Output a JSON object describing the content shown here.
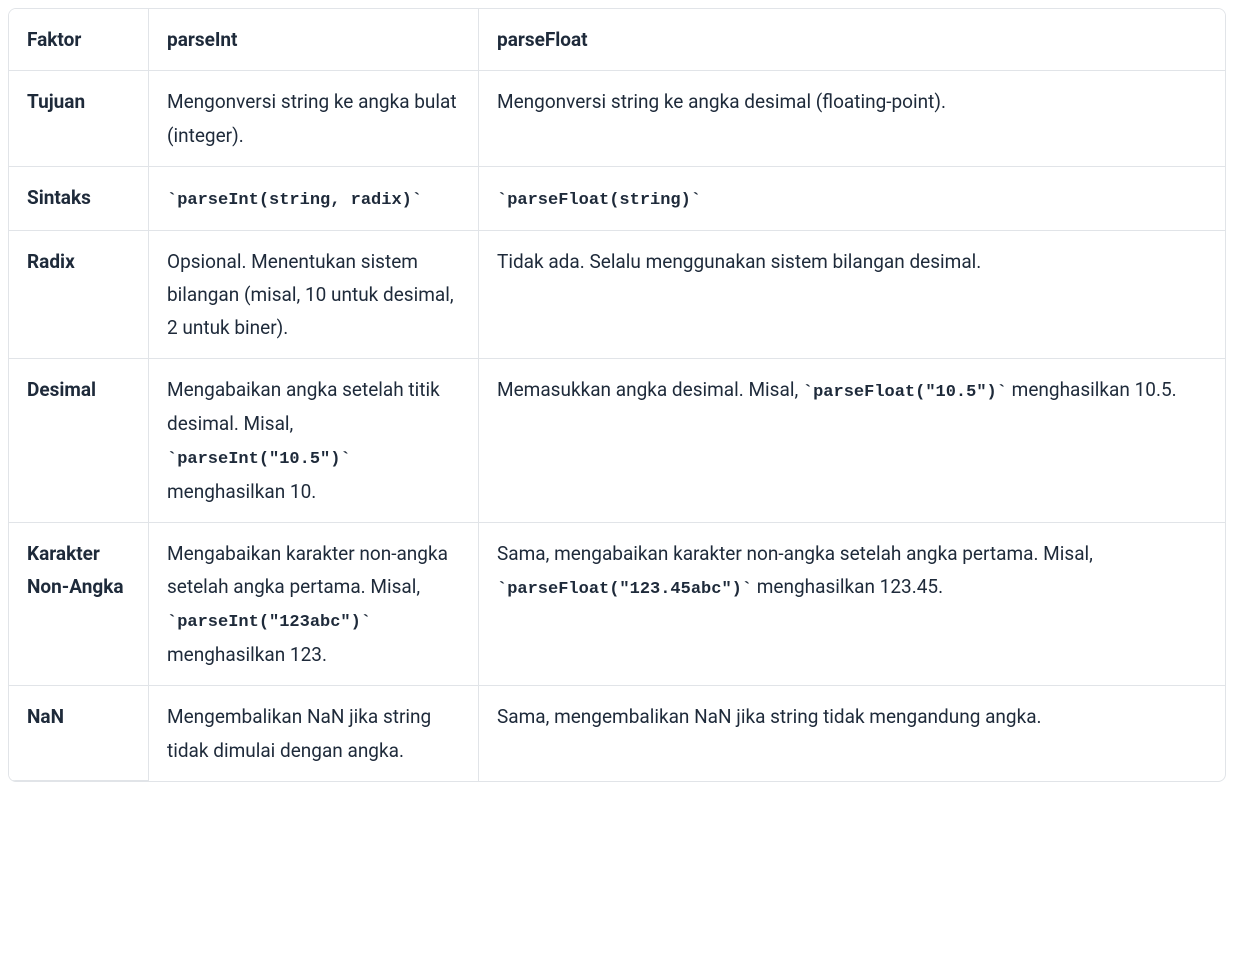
{
  "table": {
    "headers": {
      "factor": "Faktor",
      "parseInt": "parseInt",
      "parseFloat": "parseFloat"
    },
    "rows": [
      {
        "factor": "Tujuan",
        "parseInt": [
          {
            "t": "text",
            "v": "Mengonversi string ke angka bulat (integer)."
          }
        ],
        "parseFloat": [
          {
            "t": "text",
            "v": "Mengonversi string ke angka desimal (floating-point)."
          }
        ]
      },
      {
        "factor": "Sintaks",
        "parseInt": [
          {
            "t": "code",
            "v": "parseInt(string, radix)"
          }
        ],
        "parseFloat": [
          {
            "t": "code",
            "v": "parseFloat(string)"
          }
        ]
      },
      {
        "factor": "Radix",
        "parseInt": [
          {
            "t": "text",
            "v": "Opsional. Menentukan sistem bilangan (misal, 10 untuk desimal, 2 untuk biner)."
          }
        ],
        "parseFloat": [
          {
            "t": "text",
            "v": "Tidak ada. Selalu menggunakan sistem bilangan desimal."
          }
        ]
      },
      {
        "factor": "Desimal",
        "parseInt": [
          {
            "t": "text",
            "v": "Mengabaikan angka setelah titik desimal. Misal, "
          },
          {
            "t": "code",
            "v": "parseInt(\"10.5\")"
          },
          {
            "t": "text",
            "v": " menghasilkan 10."
          }
        ],
        "parseFloat": [
          {
            "t": "text",
            "v": "Memasukkan angka desimal. Misal, "
          },
          {
            "t": "code",
            "v": "parseFloat(\"10.5\")"
          },
          {
            "t": "text",
            "v": " menghasilkan 10.5."
          }
        ]
      },
      {
        "factor": "Karakter Non-Angka",
        "parseInt": [
          {
            "t": "text",
            "v": "Mengabaikan karakter non-angka setelah angka pertama. Misal, "
          },
          {
            "t": "code",
            "v": "parseInt(\"123abc\")"
          },
          {
            "t": "text",
            "v": " menghasilkan 123."
          }
        ],
        "parseFloat": [
          {
            "t": "text",
            "v": "Sama, mengabaikan karakter non-angka setelah angka pertama. Misal, "
          },
          {
            "t": "code",
            "v": "parseFloat(\"123.45abc\")"
          },
          {
            "t": "text",
            "v": " menghasilkan 123.45."
          }
        ]
      },
      {
        "factor": "NaN",
        "parseInt": [
          {
            "t": "text",
            "v": "Mengembalikan NaN jika string tidak dimulai dengan angka."
          }
        ],
        "parseFloat": [
          {
            "t": "text",
            "v": "Sama, mengembalikan NaN jika string tidak mengandung angka."
          }
        ]
      }
    ]
  }
}
